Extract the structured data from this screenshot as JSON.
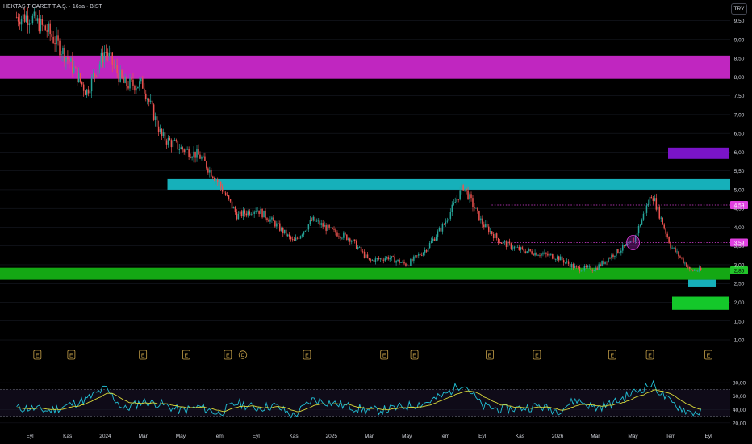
{
  "header": {
    "title": "HEKTAŞ TİCARET T.A.Ş. · 16sa · BIST",
    "currency_button": "TRY"
  },
  "chart_data": {
    "type": "candlestick",
    "symbol": "HEKTAŞ TİCARET T.A.Ş.",
    "interval": "16sa",
    "exchange": "BIST",
    "currency": "TRY",
    "price_axis": {
      "range": [
        0.85,
        10.05
      ],
      "ticks": [
        9.5,
        9.0,
        8.5,
        8.0,
        7.5,
        7.0,
        6.5,
        6.0,
        5.5,
        5.0,
        4.5,
        4.0,
        3.5,
        3.0,
        2.5,
        2.0,
        1.5,
        1.0
      ],
      "tick_labels": [
        "9,50",
        "9,00",
        "8,50",
        "8,00",
        "7,50",
        "7,00",
        "6,50",
        "6,00",
        "5,50",
        "5,00",
        "4,50",
        "4,00",
        "3,50",
        "3,00",
        "2,50",
        "2,00",
        "1,50",
        "1,00"
      ]
    },
    "time_axis": {
      "labels": [
        "Eyl",
        "Kas",
        "2024",
        "Mar",
        "May",
        "Tem",
        "Eyl",
        "Kas",
        "2025",
        "Mar",
        "May",
        "Tem",
        "Eyl",
        "Kas",
        "2026",
        "Mar",
        "May",
        "Tem",
        "Eyl"
      ],
      "label_index": [
        0,
        2,
        4,
        6,
        8,
        10,
        12,
        14,
        16,
        18,
        20,
        22,
        24,
        26,
        28,
        30,
        32,
        34,
        36
      ],
      "projected_end_index": 37
    },
    "price_path": {
      "key_months": [
        0,
        1,
        2,
        3,
        4,
        5,
        6,
        7,
        8,
        9,
        10,
        11,
        12,
        13,
        14,
        15,
        16,
        17,
        18,
        19,
        20,
        21,
        22,
        23,
        24,
        25,
        26,
        27,
        28,
        29,
        30,
        31,
        32,
        33,
        34,
        35
      ],
      "close": [
        9.6,
        9.2,
        8.5,
        7.6,
        8.7,
        7.8,
        7.8,
        6.4,
        6.1,
        5.9,
        5.2,
        4.3,
        4.5,
        4.1,
        3.6,
        4.2,
        3.9,
        3.7,
        3.1,
        3.2,
        3.0,
        3.4,
        4.1,
        5.1,
        4.1,
        3.6,
        3.4,
        3.3,
        3.2,
        2.9,
        2.9,
        3.3,
        3.6,
        4.9,
        3.5,
        2.9
      ],
      "last_close": 2.85
    },
    "zones": [
      {
        "from": 7.95,
        "to": 8.57,
        "color": "#c026c0",
        "extent": "full"
      },
      {
        "from": 5.0,
        "to": 5.28,
        "color": "#16b0ba",
        "extent": "from-May-2024"
      },
      {
        "from": 2.6,
        "to": 2.92,
        "color": "#14a814",
        "extent": "full"
      },
      {
        "from": 5.82,
        "to": 6.12,
        "color": "#7a14c8",
        "extent": "right"
      },
      {
        "from": 2.42,
        "to": 2.6,
        "color": "#16b0ba",
        "extent": "right"
      },
      {
        "from": 1.8,
        "to": 2.15,
        "color": "#14c82a",
        "extent": "right"
      }
    ],
    "levels": [
      {
        "value": 4.59,
        "label": "4,59",
        "color": "#e040e0",
        "style": "dotted"
      },
      {
        "value": 3.59,
        "label": "3,59",
        "color": "#e040e0",
        "style": "dotted"
      },
      {
        "value": 2.85,
        "label": "2,85",
        "color": "#22c62a",
        "style": "last-price"
      }
    ],
    "events": {
      "earnings_label": "E",
      "earnings_at": [
        0.4,
        2.2,
        6.0,
        8.3,
        10.5,
        14.7,
        18.8,
        20.4,
        24.4,
        26.9,
        30.9,
        32.9,
        36.0
      ],
      "dividend_label": "D",
      "dividend_at": [
        11.3
      ],
      "color": "#c9a34a"
    },
    "rsi": {
      "axis_ticks": [
        80,
        60,
        40,
        20
      ],
      "axis_labels": [
        "80,00",
        "60,00",
        "40,00",
        "20,00"
      ],
      "band": [
        30,
        70
      ],
      "key_months": [
        0,
        1,
        2,
        3,
        4,
        5,
        6,
        7,
        8,
        9,
        10,
        11,
        12,
        13,
        14,
        15,
        16,
        17,
        18,
        19,
        20,
        21,
        22,
        23,
        24,
        25,
        26,
        27,
        28,
        29,
        30,
        31,
        32,
        33,
        34,
        35
      ],
      "values": [
        42,
        38,
        46,
        55,
        72,
        40,
        52,
        48,
        38,
        44,
        34,
        50,
        42,
        46,
        30,
        55,
        50,
        44,
        38,
        40,
        45,
        50,
        62,
        80,
        45,
        40,
        42,
        45,
        38,
        55,
        42,
        50,
        65,
        78,
        50,
        36
      ],
      "rsi_color": "#22c1d6",
      "signal_color": "#d8d83a"
    },
    "colors": {
      "up": "#26a69a",
      "down": "#ef5350",
      "grid": "#1e222d",
      "text": "#d1d4dc"
    }
  }
}
